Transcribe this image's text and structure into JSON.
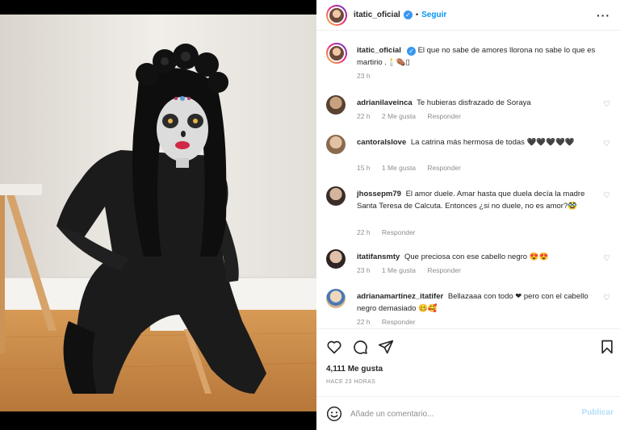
{
  "post": {
    "author": "itatic_oficial",
    "follow_label": "Seguir",
    "more_icon": "more-options-icon",
    "caption_text": "El que no sabe de amores llorona no sabe lo que es martirio .🕯️⚰️▯",
    "caption_time": "23 h"
  },
  "comments": [
    {
      "user": "adrianilaveinca",
      "text": "Te hubieras disfrazado de Soraya",
      "time": "22 h",
      "likes": "2 Me gusta",
      "reply": "Responder"
    },
    {
      "user": "cantoralslove",
      "text": "La catrina más hermosa de todas 🖤🖤🖤🖤🖤",
      "time": "15 h",
      "likes": "1 Me gusta",
      "reply": "Responder"
    },
    {
      "user": "jhossepm79",
      "text": "El amor duele. Amar hasta que duela decía la madre Santa Teresa de Calcuta. Entonces ¿si no duele, no es amor?🥸",
      "time": "22 h",
      "likes": "",
      "reply": "Responder"
    },
    {
      "user": "itatifansmty",
      "text": "Que preciosa con ese cabello negro 😍😍",
      "time": "23 h",
      "likes": "1 Me gusta",
      "reply": "Responder"
    },
    {
      "user": "adrianamartinez_itatifer",
      "text": "Bellazaaa con todo ❤ pero con el cabello negro demasiado 🥴🥰",
      "time": "22 h",
      "likes": "",
      "reply": "Responder"
    }
  ],
  "stats": {
    "likes": "4,111 Me gusta",
    "ago": "HACE 23 HORAS"
  },
  "composer": {
    "placeholder": "Añade un comentario...",
    "post_label": "Publicar"
  },
  "colors": {
    "link": "#0095f6",
    "muted": "#8e8e8e",
    "post_disabled": "#b2dffc"
  }
}
